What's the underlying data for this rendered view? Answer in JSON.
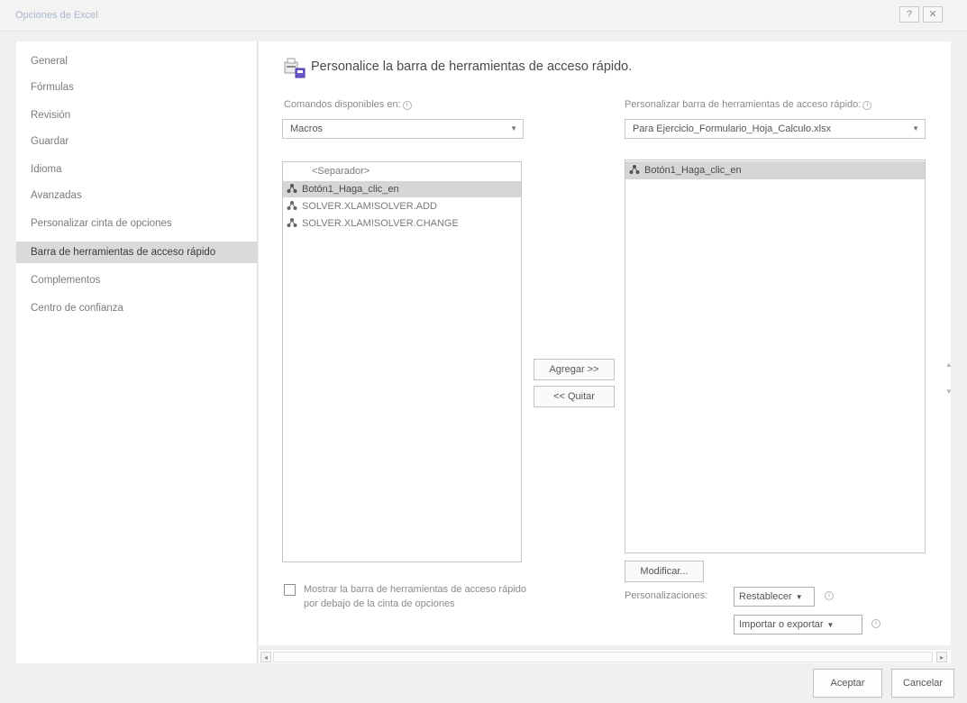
{
  "window": {
    "title": "Opciones de Excel",
    "help_label": "?",
    "close_label": "✕"
  },
  "nav": {
    "items": [
      {
        "label": "General"
      },
      {
        "label": "Fórmulas"
      },
      {
        "label": "Revisión"
      },
      {
        "label": "Guardar"
      },
      {
        "label": "Idioma"
      },
      {
        "label": "Avanzadas"
      },
      {
        "label": "Personalizar cinta de opciones"
      },
      {
        "label": "Barra de herramientas de acceso rápido"
      },
      {
        "label": "Complementos"
      },
      {
        "label": "Centro de confianza"
      }
    ],
    "active": "Barra de herramientas de acceso rápido"
  },
  "main": {
    "heading": "Personalice la barra de herramientas de acceso rápido.",
    "left": {
      "label": "Comandos disponibles en:",
      "combo_value": "Macros",
      "items": [
        {
          "label": "<Separador>"
        },
        {
          "label": "Botón1_Haga_clic_en"
        },
        {
          "label": "SOLVER.XLAM!SOLVER.ADD"
        },
        {
          "label": "SOLVER.XLAM!SOLVER.CHANGE"
        }
      ]
    },
    "right": {
      "label": "Personalizar barra de herramientas de acceso rápido:",
      "combo_value": "Para Ejercicio_Formulario_Hoja_Calculo.xlsx",
      "items": [
        {
          "label": "Botón1_Haga_clic_en"
        }
      ]
    },
    "add_button": "Agregar >>",
    "remove_button": "<< Quitar",
    "modify_button": "Modificar...",
    "customizations_label": "Personalizaciones:",
    "reset_button": "Restablecer",
    "import_export_button": "Importar o exportar",
    "move_up": "▲",
    "move_down": "▼",
    "show_below_label": "Mostrar la barra de herramientas de acceso rápido por debajo de la cinta de opciones",
    "show_below_checked": false
  },
  "footer": {
    "ok_button": "Aceptar",
    "cancel_button": "Cancelar"
  },
  "colors": {
    "selected_nav": "#dadada",
    "selected_row": "#d6d6d6",
    "title_text": "#a9b7c8"
  }
}
